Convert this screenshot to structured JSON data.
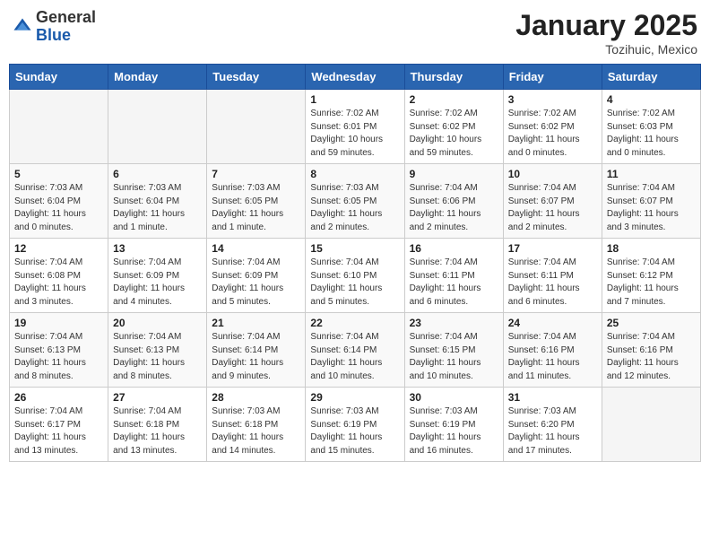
{
  "header": {
    "logo_general": "General",
    "logo_blue": "Blue",
    "month": "January 2025",
    "location": "Tozihuic, Mexico"
  },
  "weekdays": [
    "Sunday",
    "Monday",
    "Tuesday",
    "Wednesday",
    "Thursday",
    "Friday",
    "Saturday"
  ],
  "weeks": [
    [
      {
        "day": "",
        "details": ""
      },
      {
        "day": "",
        "details": ""
      },
      {
        "day": "",
        "details": ""
      },
      {
        "day": "1",
        "details": "Sunrise: 7:02 AM\nSunset: 6:01 PM\nDaylight: 10 hours\nand 59 minutes."
      },
      {
        "day": "2",
        "details": "Sunrise: 7:02 AM\nSunset: 6:02 PM\nDaylight: 10 hours\nand 59 minutes."
      },
      {
        "day": "3",
        "details": "Sunrise: 7:02 AM\nSunset: 6:02 PM\nDaylight: 11 hours\nand 0 minutes."
      },
      {
        "day": "4",
        "details": "Sunrise: 7:02 AM\nSunset: 6:03 PM\nDaylight: 11 hours\nand 0 minutes."
      }
    ],
    [
      {
        "day": "5",
        "details": "Sunrise: 7:03 AM\nSunset: 6:04 PM\nDaylight: 11 hours\nand 0 minutes."
      },
      {
        "day": "6",
        "details": "Sunrise: 7:03 AM\nSunset: 6:04 PM\nDaylight: 11 hours\nand 1 minute."
      },
      {
        "day": "7",
        "details": "Sunrise: 7:03 AM\nSunset: 6:05 PM\nDaylight: 11 hours\nand 1 minute."
      },
      {
        "day": "8",
        "details": "Sunrise: 7:03 AM\nSunset: 6:05 PM\nDaylight: 11 hours\nand 2 minutes."
      },
      {
        "day": "9",
        "details": "Sunrise: 7:04 AM\nSunset: 6:06 PM\nDaylight: 11 hours\nand 2 minutes."
      },
      {
        "day": "10",
        "details": "Sunrise: 7:04 AM\nSunset: 6:07 PM\nDaylight: 11 hours\nand 2 minutes."
      },
      {
        "day": "11",
        "details": "Sunrise: 7:04 AM\nSunset: 6:07 PM\nDaylight: 11 hours\nand 3 minutes."
      }
    ],
    [
      {
        "day": "12",
        "details": "Sunrise: 7:04 AM\nSunset: 6:08 PM\nDaylight: 11 hours\nand 3 minutes."
      },
      {
        "day": "13",
        "details": "Sunrise: 7:04 AM\nSunset: 6:09 PM\nDaylight: 11 hours\nand 4 minutes."
      },
      {
        "day": "14",
        "details": "Sunrise: 7:04 AM\nSunset: 6:09 PM\nDaylight: 11 hours\nand 5 minutes."
      },
      {
        "day": "15",
        "details": "Sunrise: 7:04 AM\nSunset: 6:10 PM\nDaylight: 11 hours\nand 5 minutes."
      },
      {
        "day": "16",
        "details": "Sunrise: 7:04 AM\nSunset: 6:11 PM\nDaylight: 11 hours\nand 6 minutes."
      },
      {
        "day": "17",
        "details": "Sunrise: 7:04 AM\nSunset: 6:11 PM\nDaylight: 11 hours\nand 6 minutes."
      },
      {
        "day": "18",
        "details": "Sunrise: 7:04 AM\nSunset: 6:12 PM\nDaylight: 11 hours\nand 7 minutes."
      }
    ],
    [
      {
        "day": "19",
        "details": "Sunrise: 7:04 AM\nSunset: 6:13 PM\nDaylight: 11 hours\nand 8 minutes."
      },
      {
        "day": "20",
        "details": "Sunrise: 7:04 AM\nSunset: 6:13 PM\nDaylight: 11 hours\nand 8 minutes."
      },
      {
        "day": "21",
        "details": "Sunrise: 7:04 AM\nSunset: 6:14 PM\nDaylight: 11 hours\nand 9 minutes."
      },
      {
        "day": "22",
        "details": "Sunrise: 7:04 AM\nSunset: 6:14 PM\nDaylight: 11 hours\nand 10 minutes."
      },
      {
        "day": "23",
        "details": "Sunrise: 7:04 AM\nSunset: 6:15 PM\nDaylight: 11 hours\nand 10 minutes."
      },
      {
        "day": "24",
        "details": "Sunrise: 7:04 AM\nSunset: 6:16 PM\nDaylight: 11 hours\nand 11 minutes."
      },
      {
        "day": "25",
        "details": "Sunrise: 7:04 AM\nSunset: 6:16 PM\nDaylight: 11 hours\nand 12 minutes."
      }
    ],
    [
      {
        "day": "26",
        "details": "Sunrise: 7:04 AM\nSunset: 6:17 PM\nDaylight: 11 hours\nand 13 minutes."
      },
      {
        "day": "27",
        "details": "Sunrise: 7:04 AM\nSunset: 6:18 PM\nDaylight: 11 hours\nand 13 minutes."
      },
      {
        "day": "28",
        "details": "Sunrise: 7:03 AM\nSunset: 6:18 PM\nDaylight: 11 hours\nand 14 minutes."
      },
      {
        "day": "29",
        "details": "Sunrise: 7:03 AM\nSunset: 6:19 PM\nDaylight: 11 hours\nand 15 minutes."
      },
      {
        "day": "30",
        "details": "Sunrise: 7:03 AM\nSunset: 6:19 PM\nDaylight: 11 hours\nand 16 minutes."
      },
      {
        "day": "31",
        "details": "Sunrise: 7:03 AM\nSunset: 6:20 PM\nDaylight: 11 hours\nand 17 minutes."
      },
      {
        "day": "",
        "details": ""
      }
    ]
  ]
}
